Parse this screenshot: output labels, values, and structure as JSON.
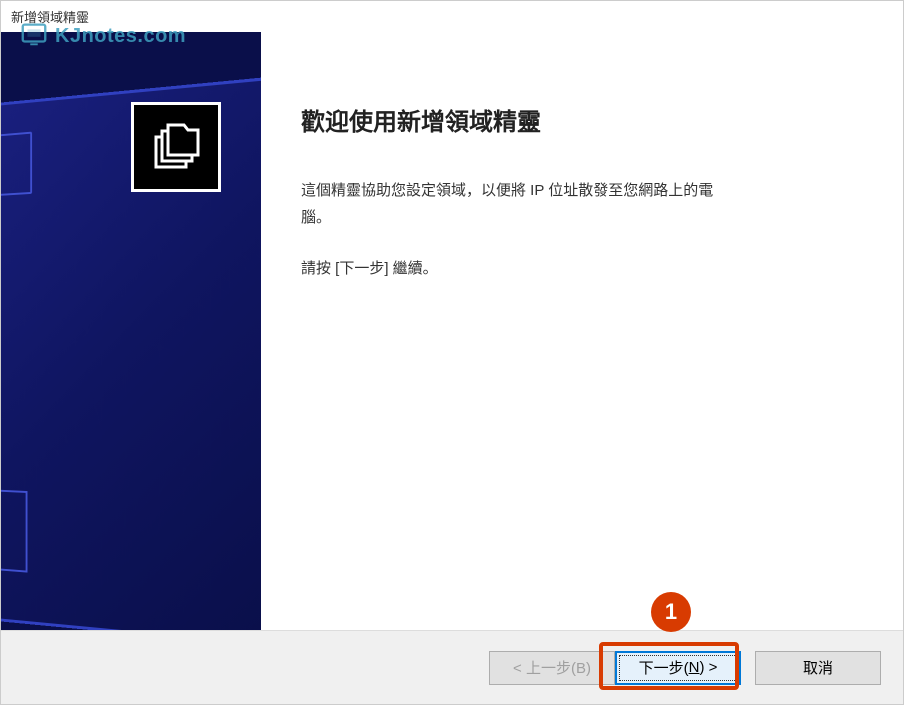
{
  "window": {
    "title": "新增領域精靈"
  },
  "watermark": {
    "text": "KJnotes.com"
  },
  "wizard": {
    "heading": "歡迎使用新增領域精靈",
    "description_line1": "這個精靈協助您設定領域，以便將 IP 位址散發至您網路上的電",
    "description_line2": "腦。",
    "continue_hint": "請按 [下一步] 繼續。"
  },
  "buttons": {
    "back": "< 上一步(B)",
    "next_prefix": "下一步(",
    "next_key": "N",
    "next_suffix": ") >",
    "cancel": "取消"
  },
  "callout": {
    "number": "1"
  }
}
